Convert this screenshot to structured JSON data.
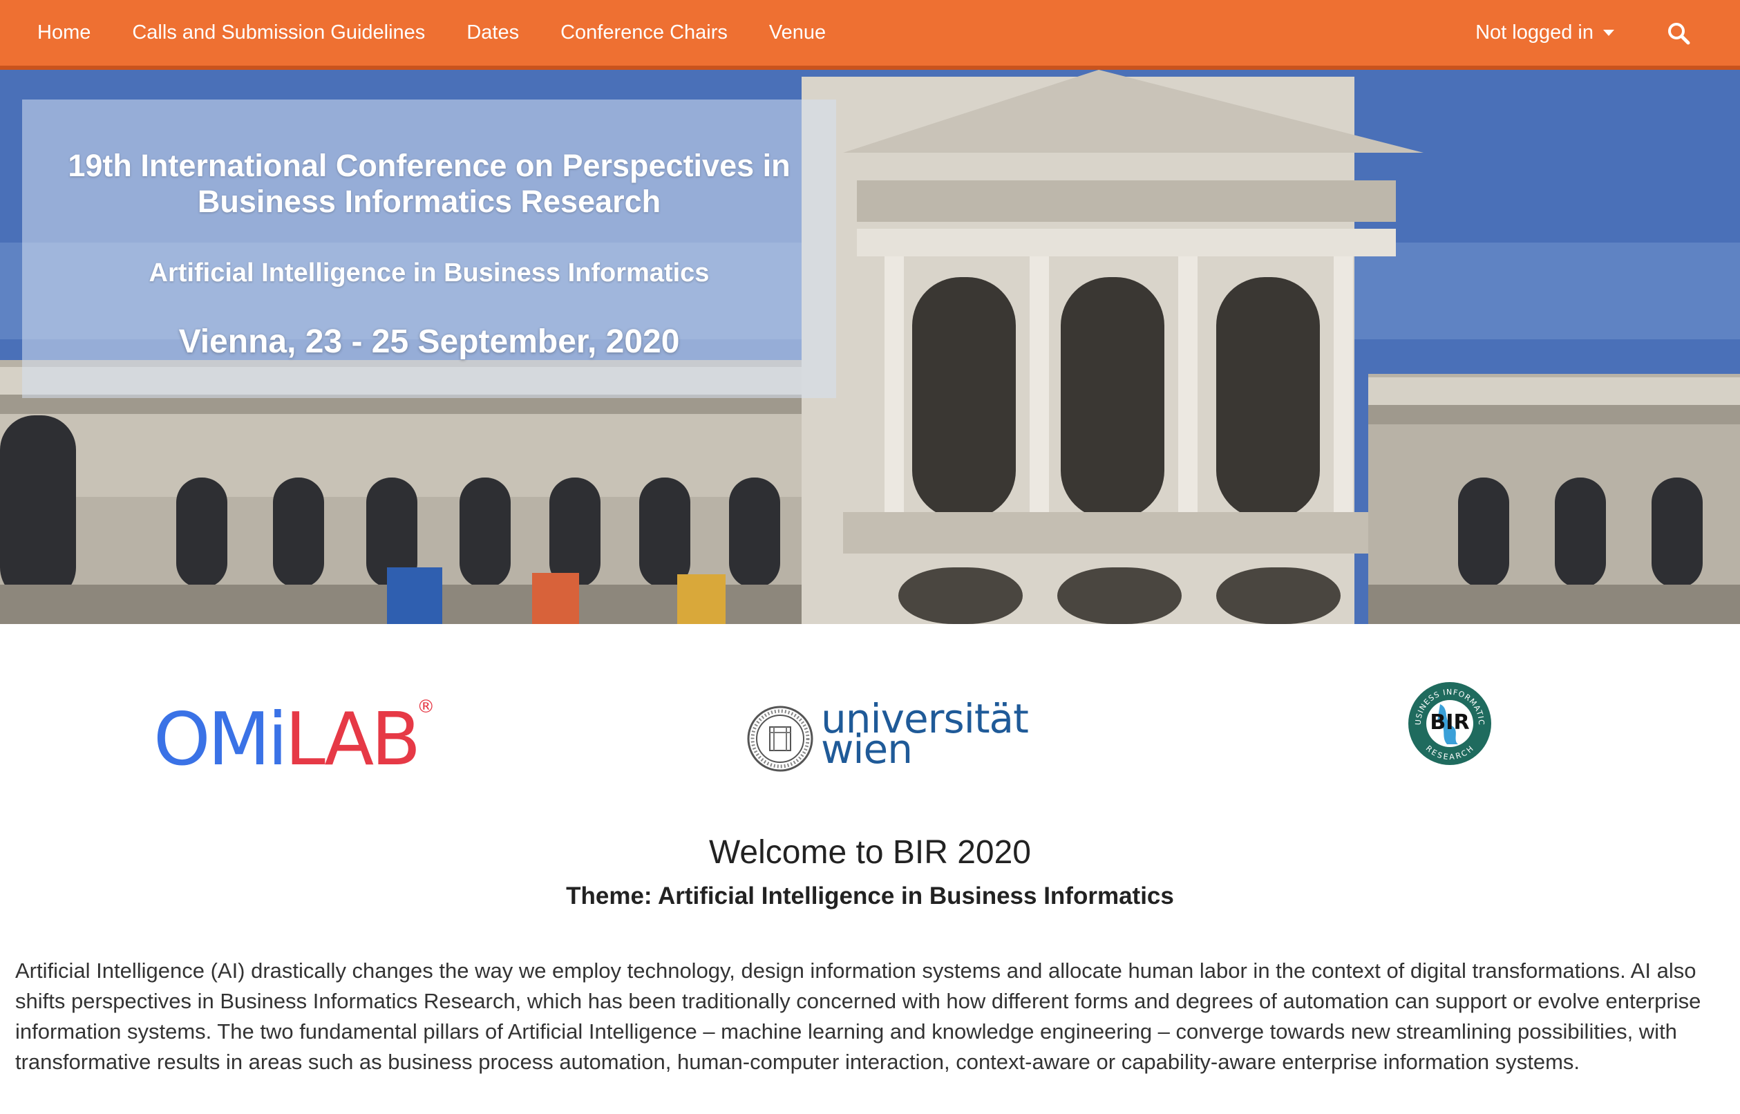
{
  "nav": {
    "links": [
      "Home",
      "Calls and Submission Guidelines",
      "Dates",
      "Conference Chairs",
      "Venue"
    ],
    "user_menu": "Not logged in",
    "search_icon": "search-icon"
  },
  "hero": {
    "title_line1": "19th International Conference on Perspectives in",
    "title_line2": "Business Informatics Research",
    "subtitle": "Artificial Intelligence in Business Informatics",
    "dates": "Vienna, 23 - 25 September, 2020"
  },
  "logos": {
    "omilab": {
      "part1": "OMi",
      "part2": "LAB",
      "reg": "®"
    },
    "uniwien": {
      "line1": "universität",
      "line2": "wien"
    },
    "bir": {
      "center": "BIR",
      "ring_top": "BUSINESS INFORMATICS",
      "ring_bottom": "RESEARCH"
    }
  },
  "content": {
    "welcome": "Welcome to BIR 2020",
    "theme": "Theme: Artificial Intelligence in Business Informatics",
    "intro": "Artificial Intelligence (AI) drastically changes the way we employ technology, design information systems and allocate human labor in the context of digital transformations. AI also shifts perspectives in Business Informatics Research, which has been traditionally concerned with how different forms and degrees of automation can support or evolve enterprise information systems. The two fundamental pillars of Artificial Intelligence – machine learning and knowledge engineering – converge towards new streamlining possibilities, with transformative results in areas such as business process automation, human-computer interaction, context-aware or capability-aware enterprise information systems."
  },
  "colors": {
    "navbar": "#ee7032",
    "omilab_blue": "#3a72e6",
    "omilab_red": "#e63946",
    "uniwien_blue": "#1f5a98",
    "bir_teal": "#1f6b5e"
  }
}
